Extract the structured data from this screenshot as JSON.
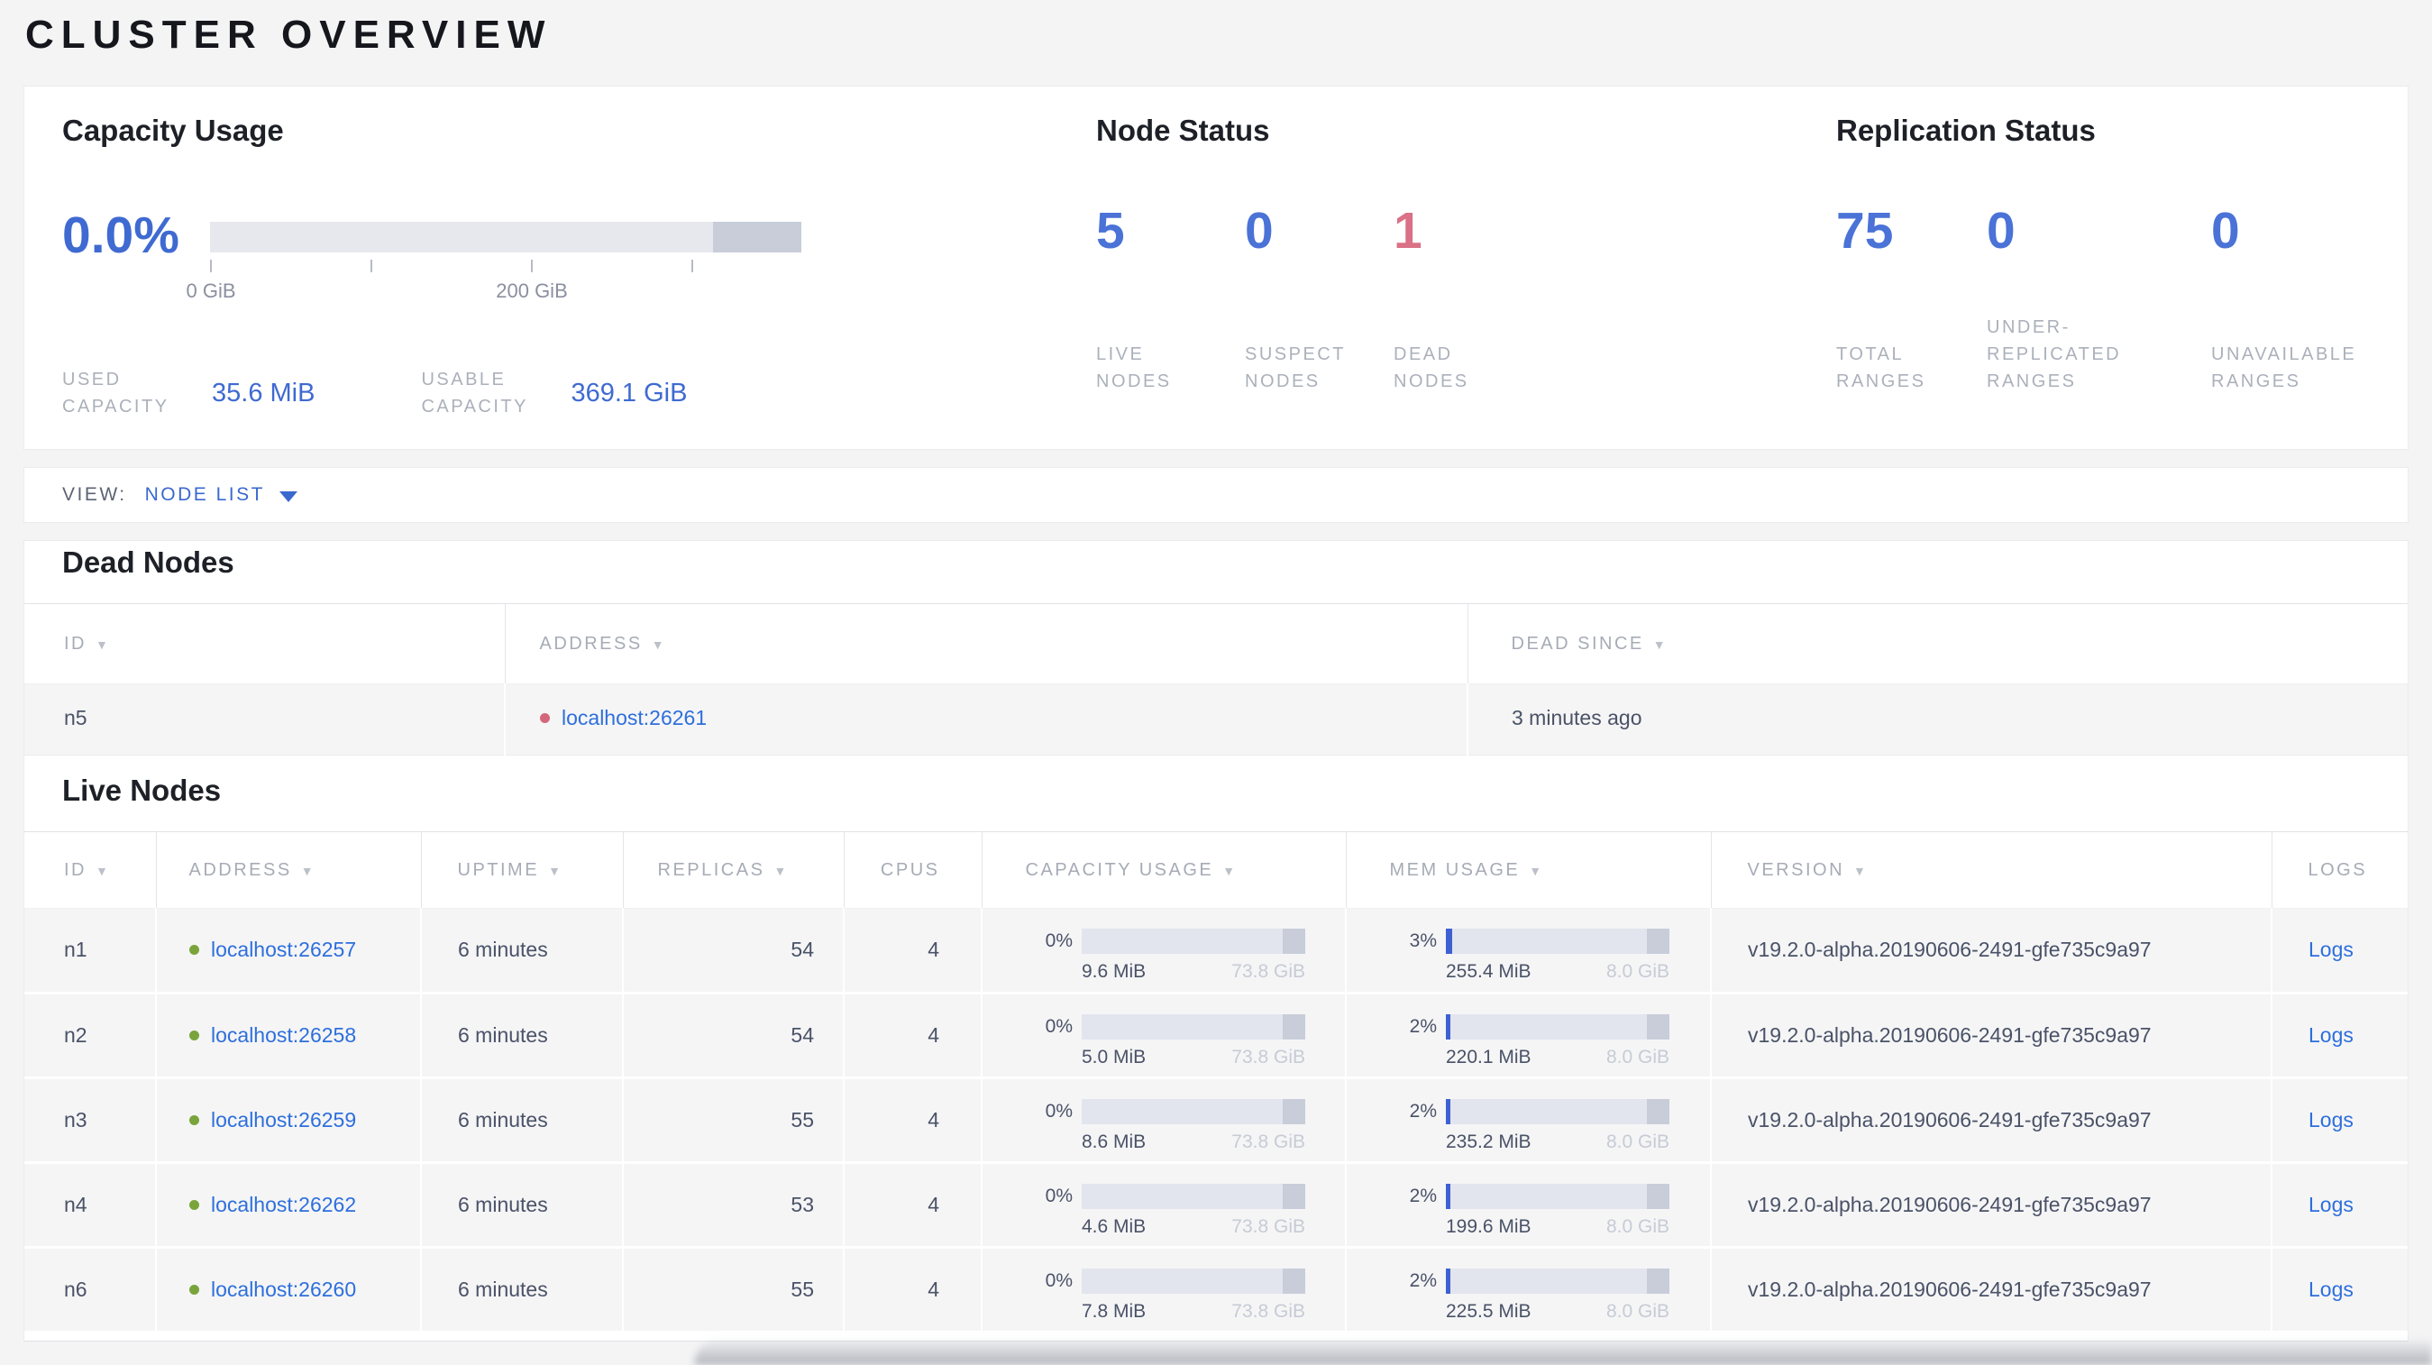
{
  "page_title": "CLUSTER OVERVIEW",
  "colors": {
    "accent_blue": "#3f6ad1",
    "link_blue": "#2d6fdc",
    "danger_red": "#da7186",
    "live_dot_green": "#79a43b",
    "dead_dot_red": "#d5677b",
    "bar_background": "#e2e5ed",
    "bar_dark_segment": "#c8cdd9",
    "bar_fill_blue": "#3e61d2"
  },
  "summary": {
    "capacity": {
      "title": "Capacity Usage",
      "percent": "0.0%",
      "tick_labels": [
        "0 GiB",
        "200 GiB"
      ],
      "used_label": "USED CAPACITY",
      "used_value": "35.6 MiB",
      "usable_label": "USABLE CAPACITY",
      "usable_value": "369.1 GiB"
    },
    "node_status": {
      "title": "Node Status",
      "stats": [
        {
          "value": "5",
          "label": "LIVE NODES",
          "tone": "blue"
        },
        {
          "value": "0",
          "label": "SUSPECT NODES",
          "tone": "blue"
        },
        {
          "value": "1",
          "label": "DEAD NODES",
          "tone": "red"
        }
      ]
    },
    "replication": {
      "title": "Replication Status",
      "stats": [
        {
          "value": "75",
          "label": "TOTAL RANGES"
        },
        {
          "value": "0",
          "label": "UNDER-REPLICATED RANGES"
        },
        {
          "value": "0",
          "label": "UNAVAILABLE RANGES"
        }
      ]
    }
  },
  "view_bar": {
    "label": "VIEW:",
    "selected": "NODE LIST"
  },
  "dead_nodes": {
    "title": "Dead Nodes",
    "columns": [
      {
        "key": "id",
        "label": "ID",
        "sortable": true
      },
      {
        "key": "address",
        "label": "ADDRESS",
        "sortable": true
      },
      {
        "key": "dead-since",
        "label": "DEAD SINCE",
        "sortable": true
      }
    ],
    "rows": [
      {
        "id": "n5",
        "address": "localhost:26261",
        "dead_since": "3 minutes ago"
      }
    ]
  },
  "live_nodes": {
    "title": "Live Nodes",
    "columns": [
      {
        "key": "id",
        "label": "ID",
        "sortable": true
      },
      {
        "key": "address",
        "label": "ADDRESS",
        "sortable": true
      },
      {
        "key": "uptime",
        "label": "UPTIME",
        "sortable": true
      },
      {
        "key": "replicas",
        "label": "REPLICAS",
        "sortable": true
      },
      {
        "key": "cpus",
        "label": "CPUS",
        "sortable": false
      },
      {
        "key": "capacity",
        "label": "CAPACITY USAGE",
        "sortable": true
      },
      {
        "key": "mem",
        "label": "MEM USAGE",
        "sortable": true
      },
      {
        "key": "version",
        "label": "VERSION",
        "sortable": true
      },
      {
        "key": "logs",
        "label": "LOGS",
        "sortable": false
      }
    ],
    "rows": [
      {
        "id": "n1",
        "address": "localhost:26257",
        "uptime": "6 minutes",
        "replicas": "54",
        "cpus": "4",
        "capacity": {
          "pct_label": "0%",
          "pct": 0,
          "used": "9.6 MiB",
          "total": "73.8 GiB"
        },
        "mem": {
          "pct_label": "3%",
          "pct": 3,
          "used": "255.4 MiB",
          "total": "8.0 GiB"
        },
        "version": "v19.2.0-alpha.20190606-2491-gfe735c9a97",
        "logs_label": "Logs"
      },
      {
        "id": "n2",
        "address": "localhost:26258",
        "uptime": "6 minutes",
        "replicas": "54",
        "cpus": "4",
        "capacity": {
          "pct_label": "0%",
          "pct": 0,
          "used": "5.0 MiB",
          "total": "73.8 GiB"
        },
        "mem": {
          "pct_label": "2%",
          "pct": 2,
          "used": "220.1 MiB",
          "total": "8.0 GiB"
        },
        "version": "v19.2.0-alpha.20190606-2491-gfe735c9a97",
        "logs_label": "Logs"
      },
      {
        "id": "n3",
        "address": "localhost:26259",
        "uptime": "6 minutes",
        "replicas": "55",
        "cpus": "4",
        "capacity": {
          "pct_label": "0%",
          "pct": 0,
          "used": "8.6 MiB",
          "total": "73.8 GiB"
        },
        "mem": {
          "pct_label": "2%",
          "pct": 2,
          "used": "235.2 MiB",
          "total": "8.0 GiB"
        },
        "version": "v19.2.0-alpha.20190606-2491-gfe735c9a97",
        "logs_label": "Logs"
      },
      {
        "id": "n4",
        "address": "localhost:26262",
        "uptime": "6 minutes",
        "replicas": "53",
        "cpus": "4",
        "capacity": {
          "pct_label": "0%",
          "pct": 0,
          "used": "4.6 MiB",
          "total": "73.8 GiB"
        },
        "mem": {
          "pct_label": "2%",
          "pct": 2,
          "used": "199.6 MiB",
          "total": "8.0 GiB"
        },
        "version": "v19.2.0-alpha.20190606-2491-gfe735c9a97",
        "logs_label": "Logs"
      },
      {
        "id": "n6",
        "address": "localhost:26260",
        "uptime": "6 minutes",
        "replicas": "55",
        "cpus": "4",
        "capacity": {
          "pct_label": "0%",
          "pct": 0,
          "used": "7.8 MiB",
          "total": "73.8 GiB"
        },
        "mem": {
          "pct_label": "2%",
          "pct": 2,
          "used": "225.5 MiB",
          "total": "8.0 GiB"
        },
        "version": "v19.2.0-alpha.20190606-2491-gfe735c9a97",
        "logs_label": "Logs"
      }
    ]
  }
}
